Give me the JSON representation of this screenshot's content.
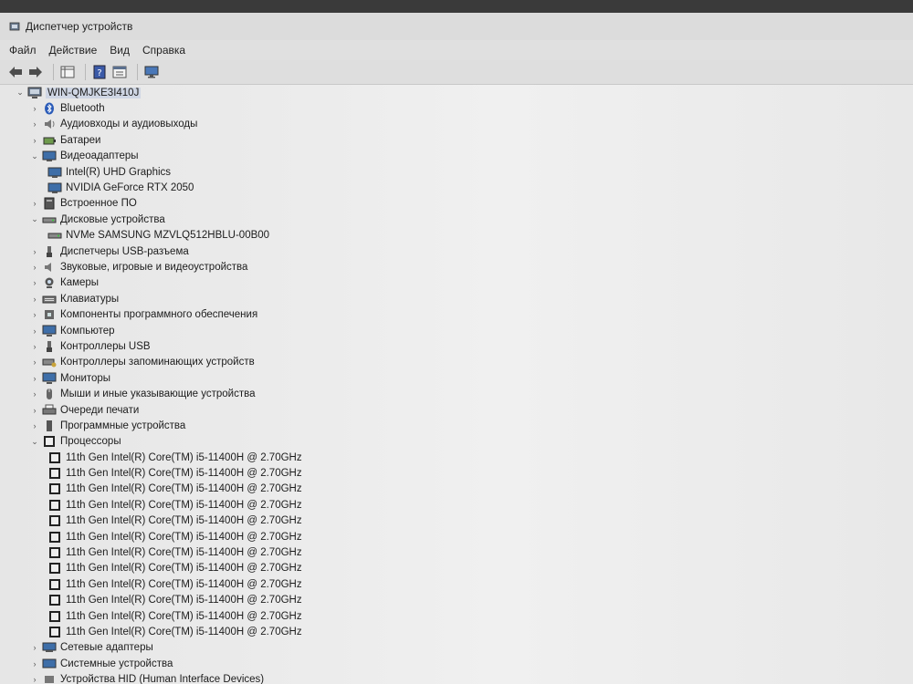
{
  "window": {
    "title": "Диспетчер устройств"
  },
  "menu": [
    "Файл",
    "Действие",
    "Вид",
    "Справка"
  ],
  "tree": {
    "root": "WIN-QMJKE3I410J",
    "categories": [
      {
        "label": "Bluetooth",
        "icon": "bluetooth-icon",
        "expanded": false,
        "children": []
      },
      {
        "label": "Аудиовходы и аудиовыходы",
        "icon": "audio-icon",
        "expanded": false,
        "children": []
      },
      {
        "label": "Батареи",
        "icon": "battery-icon",
        "expanded": false,
        "children": []
      },
      {
        "label": "Видеоадаптеры",
        "icon": "display-adapter-icon",
        "expanded": true,
        "children": [
          "Intel(R) UHD Graphics",
          "NVIDIA GeForce RTX 2050"
        ]
      },
      {
        "label": "Встроенное ПО",
        "icon": "firmware-icon",
        "expanded": false,
        "children": []
      },
      {
        "label": "Дисковые устройства",
        "icon": "disk-icon",
        "expanded": true,
        "children": [
          "NVMe SAMSUNG MZVLQ512HBLU-00B00"
        ]
      },
      {
        "label": "Диспетчеры USB-разъема",
        "icon": "usb-connector-icon",
        "expanded": false,
        "children": []
      },
      {
        "label": "Звуковые, игровые и видеоустройства",
        "icon": "sound-icon",
        "expanded": false,
        "children": []
      },
      {
        "label": "Камеры",
        "icon": "camera-icon",
        "expanded": false,
        "children": []
      },
      {
        "label": "Клавиатуры",
        "icon": "keyboard-icon",
        "expanded": false,
        "children": []
      },
      {
        "label": "Компоненты программного обеспечения",
        "icon": "software-component-icon",
        "expanded": false,
        "children": []
      },
      {
        "label": "Компьютер",
        "icon": "computer-icon",
        "expanded": false,
        "children": []
      },
      {
        "label": "Контроллеры USB",
        "icon": "usb-icon",
        "expanded": false,
        "children": []
      },
      {
        "label": "Контроллеры запоминающих устройств",
        "icon": "storage-controller-icon",
        "expanded": false,
        "children": []
      },
      {
        "label": "Мониторы",
        "icon": "monitor-icon",
        "expanded": false,
        "children": []
      },
      {
        "label": "Мыши и иные указывающие устройства",
        "icon": "mouse-icon",
        "expanded": false,
        "children": []
      },
      {
        "label": "Очереди печати",
        "icon": "printer-icon",
        "expanded": false,
        "children": []
      },
      {
        "label": "Программные устройства",
        "icon": "software-device-icon",
        "expanded": false,
        "children": []
      },
      {
        "label": "Процессоры",
        "icon": "processor-icon",
        "expanded": true,
        "children": [
          "11th Gen Intel(R) Core(TM) i5-11400H @ 2.70GHz",
          "11th Gen Intel(R) Core(TM) i5-11400H @ 2.70GHz",
          "11th Gen Intel(R) Core(TM) i5-11400H @ 2.70GHz",
          "11th Gen Intel(R) Core(TM) i5-11400H @ 2.70GHz",
          "11th Gen Intel(R) Core(TM) i5-11400H @ 2.70GHz",
          "11th Gen Intel(R) Core(TM) i5-11400H @ 2.70GHz",
          "11th Gen Intel(R) Core(TM) i5-11400H @ 2.70GHz",
          "11th Gen Intel(R) Core(TM) i5-11400H @ 2.70GHz",
          "11th Gen Intel(R) Core(TM) i5-11400H @ 2.70GHz",
          "11th Gen Intel(R) Core(TM) i5-11400H @ 2.70GHz",
          "11th Gen Intel(R) Core(TM) i5-11400H @ 2.70GHz",
          "11th Gen Intel(R) Core(TM) i5-11400H @ 2.70GHz"
        ]
      },
      {
        "label": "Сетевые адаптеры",
        "icon": "network-adapter-icon",
        "expanded": false,
        "children": []
      },
      {
        "label": "Системные устройства",
        "icon": "system-device-icon",
        "expanded": false,
        "children": []
      },
      {
        "label": "Устройства HID (Human Interface Devices)",
        "icon": "hid-icon",
        "expanded": false,
        "children": []
      }
    ]
  }
}
